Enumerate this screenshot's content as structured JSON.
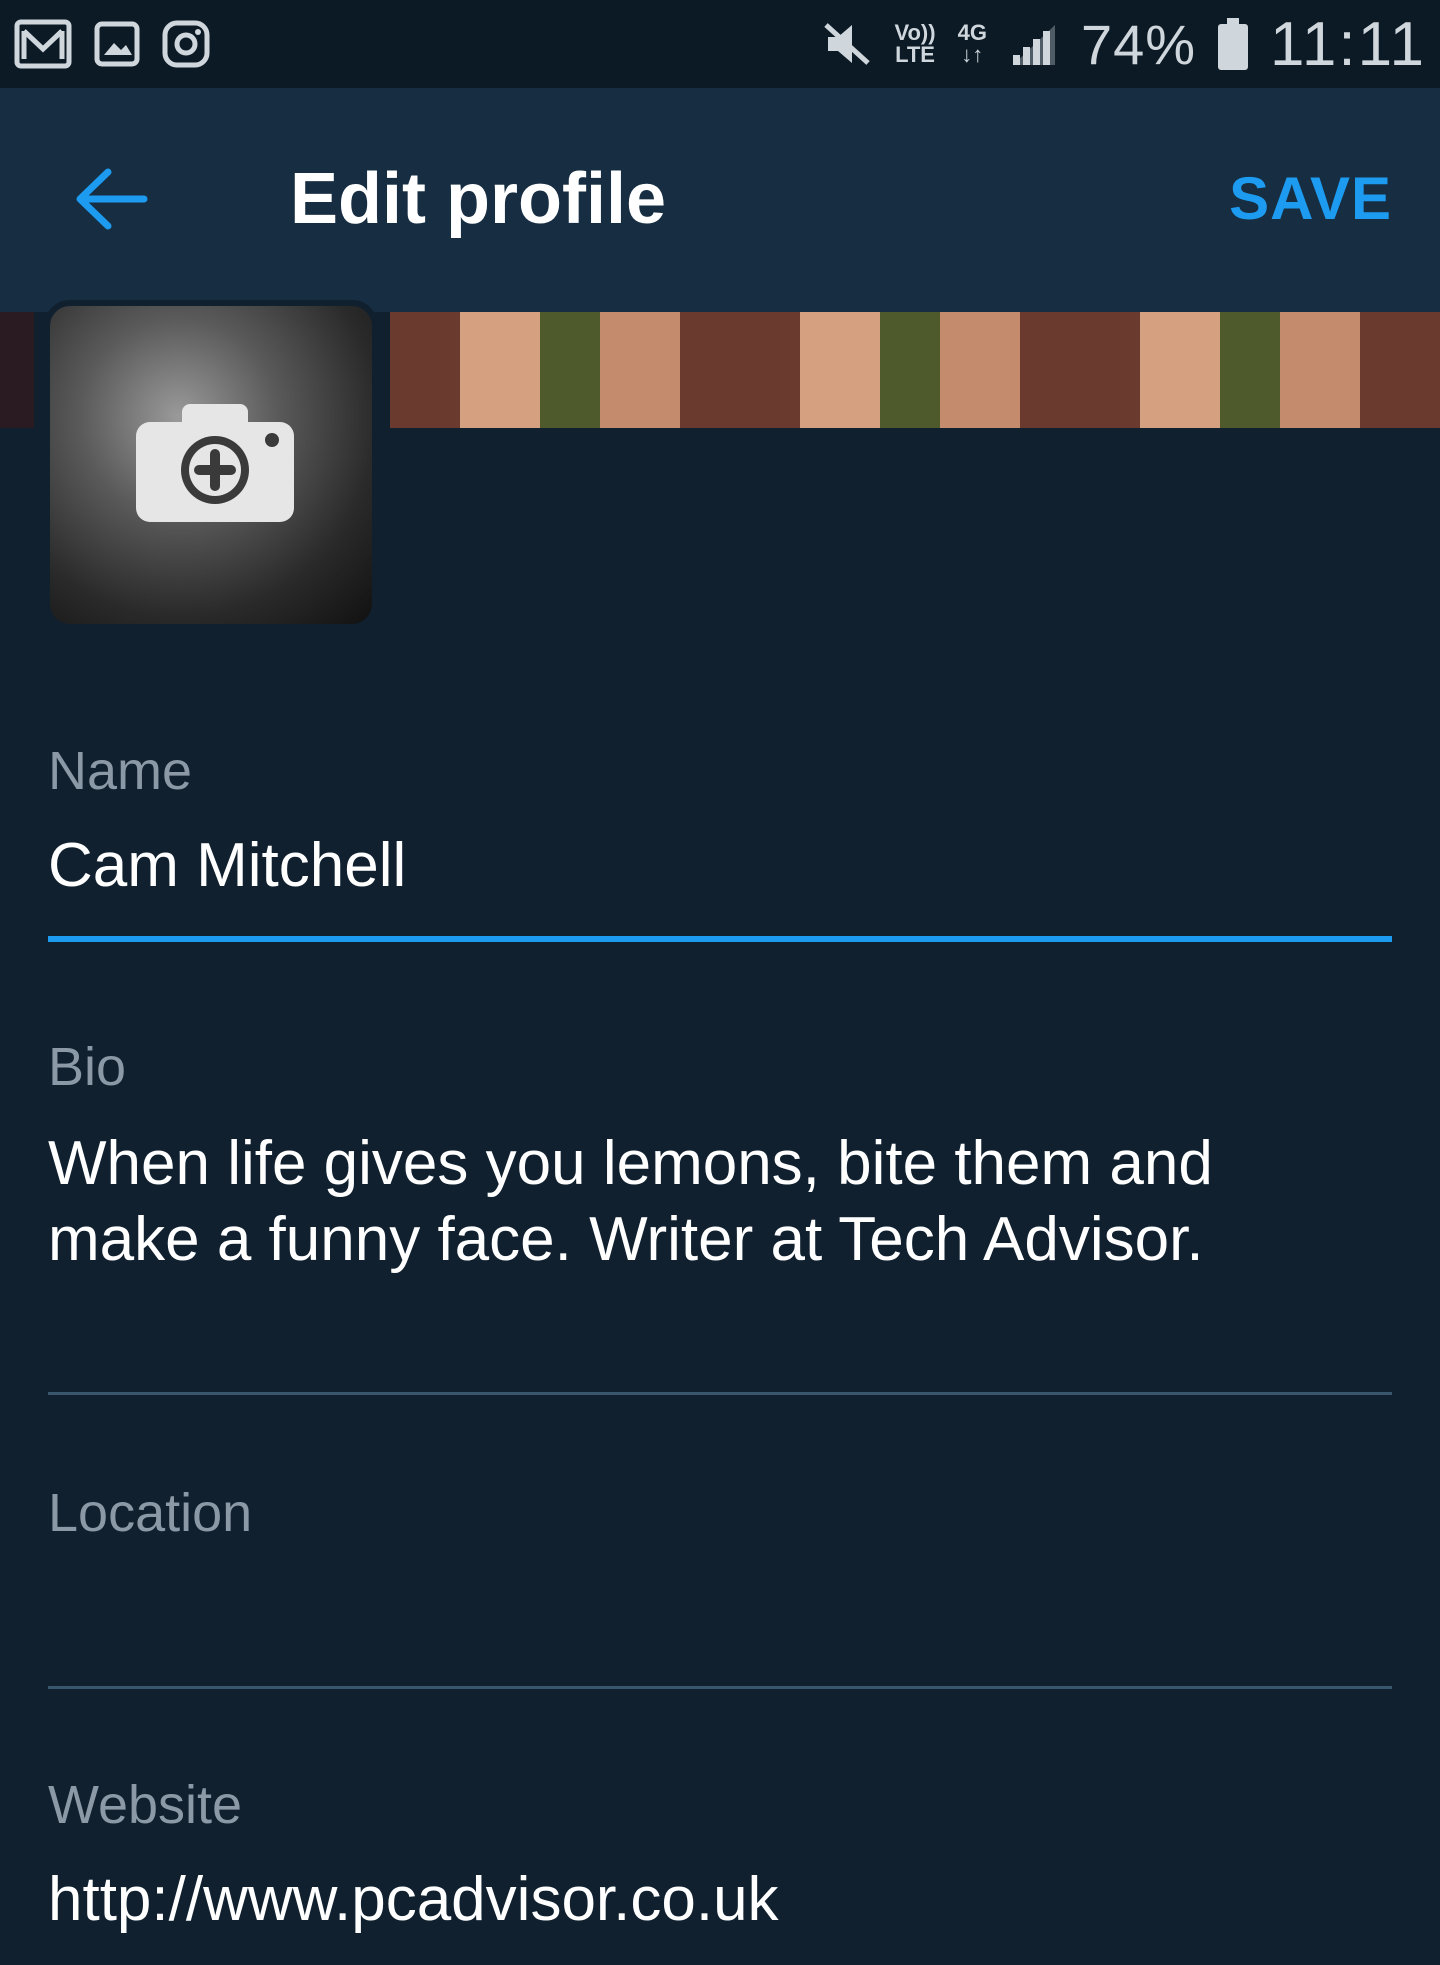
{
  "status_bar": {
    "network_type": "4G",
    "volte_top": "Vo))",
    "volte_bottom": "LTE",
    "battery": "74%",
    "time": "11:11",
    "icons": [
      "gmail-icon",
      "gallery-icon",
      "instagram-icon",
      "mute-icon",
      "signal-icon",
      "battery-icon"
    ]
  },
  "toolbar": {
    "title": "Edit profile",
    "save_label": "SAVE",
    "back_icon": "arrow-left-icon",
    "accent": "#1d9bf0"
  },
  "profile": {
    "avatar_icon": "camera-plus-icon"
  },
  "form": {
    "name": {
      "label": "Name",
      "value": "Cam Mitchell"
    },
    "bio": {
      "label": "Bio",
      "value_line1": "When life gives you lemons, bite them and",
      "value_line2": "make a funny face. Writer at Tech Advisor."
    },
    "location": {
      "label": "Location",
      "value": ""
    },
    "website": {
      "label": "Website",
      "value": "http://www.pcadvisor.co.uk"
    }
  },
  "colors": {
    "background": "#10202f",
    "toolbar": "#162d42",
    "label": "#8b98a5",
    "divider": "#38576c"
  }
}
